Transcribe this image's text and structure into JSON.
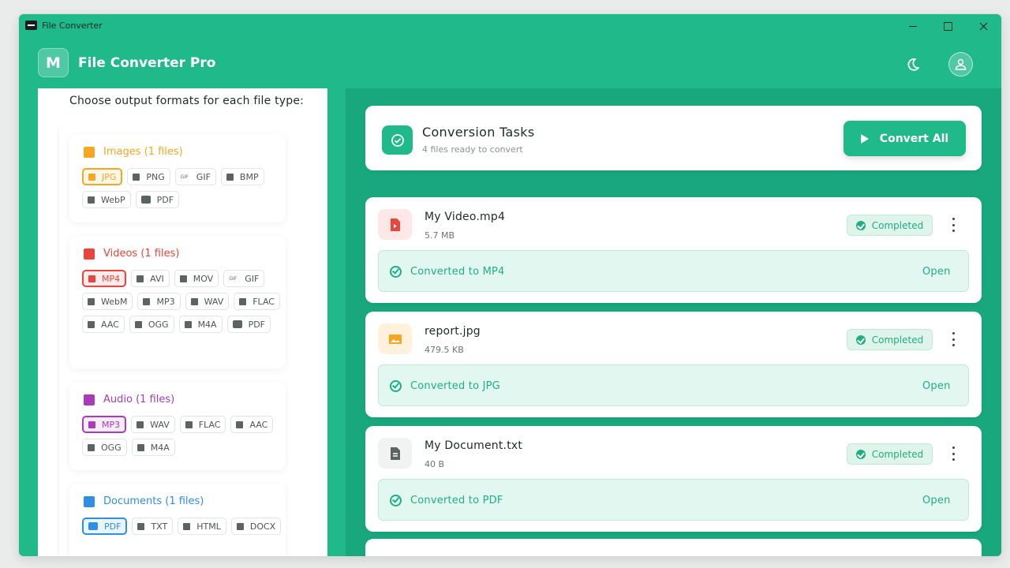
{
  "window": {
    "title": "File Converter"
  },
  "header": {
    "logo_letter": "M",
    "app_title": "File Converter Pro"
  },
  "sidebar": {
    "heading": "Choose output formats for each file type:",
    "groups": [
      {
        "title": "Images (1 files)",
        "color": "#f5a623",
        "formats": [
          "JPG",
          "PNG",
          "GIF",
          "BMP",
          "WebP",
          "PDF"
        ],
        "selected": "JPG"
      },
      {
        "title": "Videos (1 files)",
        "color": "#e8453c",
        "formats": [
          "MP4",
          "AVI",
          "MOV",
          "GIF",
          "WebM",
          "MP3",
          "WAV",
          "FLAC",
          "AAC",
          "OGG",
          "M4A",
          "PDF"
        ],
        "selected": "MP4"
      },
      {
        "title": "Audio (1 files)",
        "color": "#a63cb8",
        "formats": [
          "MP3",
          "WAV",
          "FLAC",
          "AAC",
          "OGG",
          "M4A"
        ],
        "selected": "MP3"
      },
      {
        "title": "Documents (1 files)",
        "color": "#2f8fe0",
        "formats": [
          "PDF",
          "TXT",
          "HTML",
          "DOCX"
        ],
        "selected": "PDF"
      }
    ]
  },
  "tasks": {
    "title": "Conversion Tasks",
    "subtitle": "4 files ready to convert",
    "convert_all_label": "Convert All"
  },
  "files": [
    {
      "name": "My Video.mp4",
      "size": "5.7 MB",
      "status": "Completed",
      "result": "Converted to MP4",
      "action": "Open",
      "icon": "video-file-icon",
      "icon_color": "#e8453c",
      "icon_bg": "#fde8e7"
    },
    {
      "name": "report.jpg",
      "size": "479.5 KB",
      "status": "Completed",
      "result": "Converted to JPG",
      "action": "Open",
      "icon": "image-file-icon",
      "icon_color": "#f5a623",
      "icon_bg": "#fff1db"
    },
    {
      "name": "My Document.txt",
      "size": "40 B",
      "status": "Completed",
      "result": "Converted to PDF",
      "action": "Open",
      "icon": "document-file-icon",
      "icon_color": "#5c6462",
      "icon_bg": "#f1f2f2"
    }
  ]
}
